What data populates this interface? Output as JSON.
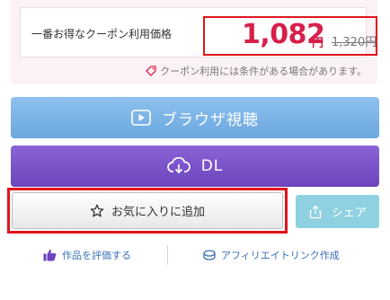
{
  "price": {
    "label": "一番お得なクーポン利用価格",
    "value": "1,082",
    "currency": "円",
    "original": "1,320円",
    "coupon_note": "クーポン利用には条件がある場合があります。"
  },
  "buttons": {
    "browser_view": "ブラウザ視聴",
    "download": "DL",
    "favorite": "お気に入りに追加",
    "share": "シェア"
  },
  "links": {
    "rate": "作品を評価する",
    "affiliate": "アフィリエイトリンク作成"
  },
  "colors": {
    "price_accent": "#d6204b",
    "highlight_frame": "#e0141e",
    "browser_button": "#7cb4e8",
    "download_button": "#7a54c9",
    "share_button": "#8fd1e0",
    "link": "#3b6fb8"
  },
  "icons": {
    "coupon": "tag-icon",
    "browser": "play-icon",
    "download": "cloud-download-icon",
    "favorite": "star-outline-icon",
    "share": "share-upload-icon",
    "rate": "thumbs-up-icon",
    "affiliate": "link-coin-icon"
  }
}
